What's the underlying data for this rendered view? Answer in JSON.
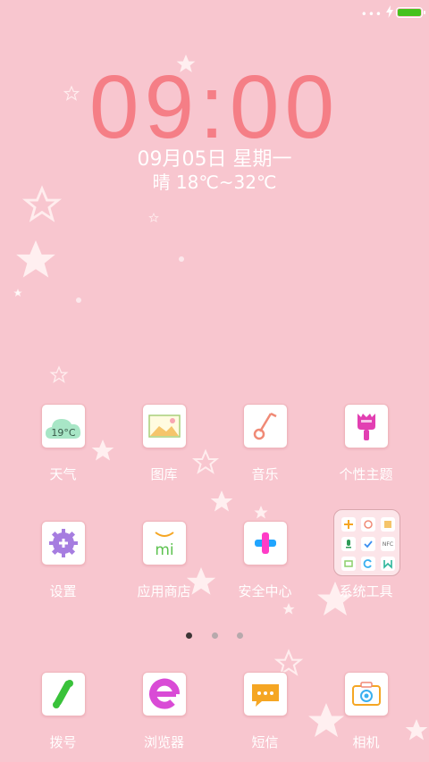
{
  "status_bar": {
    "dots": "•••",
    "battery_level": 1.0,
    "charging": true,
    "battery_color": "#46c21d"
  },
  "clock": {
    "time": "09:00",
    "date": "09月05日  星期一",
    "weather": "晴 18℃~32℃"
  },
  "home": {
    "rows": [
      {
        "apps": [
          {
            "label": "天气",
            "icon": "weather-icon",
            "icon_text": "19°C"
          },
          {
            "label": "图库",
            "icon": "gallery-icon"
          },
          {
            "label": "音乐",
            "icon": "music-icon"
          },
          {
            "label": "个性主题",
            "icon": "theme-icon"
          }
        ]
      },
      {
        "apps": [
          {
            "label": "设置",
            "icon": "settings-icon"
          },
          {
            "label": "应用商店",
            "icon": "app-store-icon",
            "icon_text": "mi"
          },
          {
            "label": "安全中心",
            "icon": "security-icon"
          },
          {
            "label": "系统工具",
            "icon": "folder-icon",
            "mini_text": "NFC"
          }
        ]
      }
    ],
    "page_count": 3,
    "active_page": 1
  },
  "dock": {
    "apps": [
      {
        "label": "拨号",
        "icon": "phone-icon"
      },
      {
        "label": "浏览器",
        "icon": "browser-icon"
      },
      {
        "label": "短信",
        "icon": "sms-icon"
      },
      {
        "label": "相机",
        "icon": "camera-icon"
      }
    ]
  },
  "colors": {
    "background": "#f8c6cf",
    "clock": "#f57e86",
    "accent_green": "#46c21d"
  }
}
